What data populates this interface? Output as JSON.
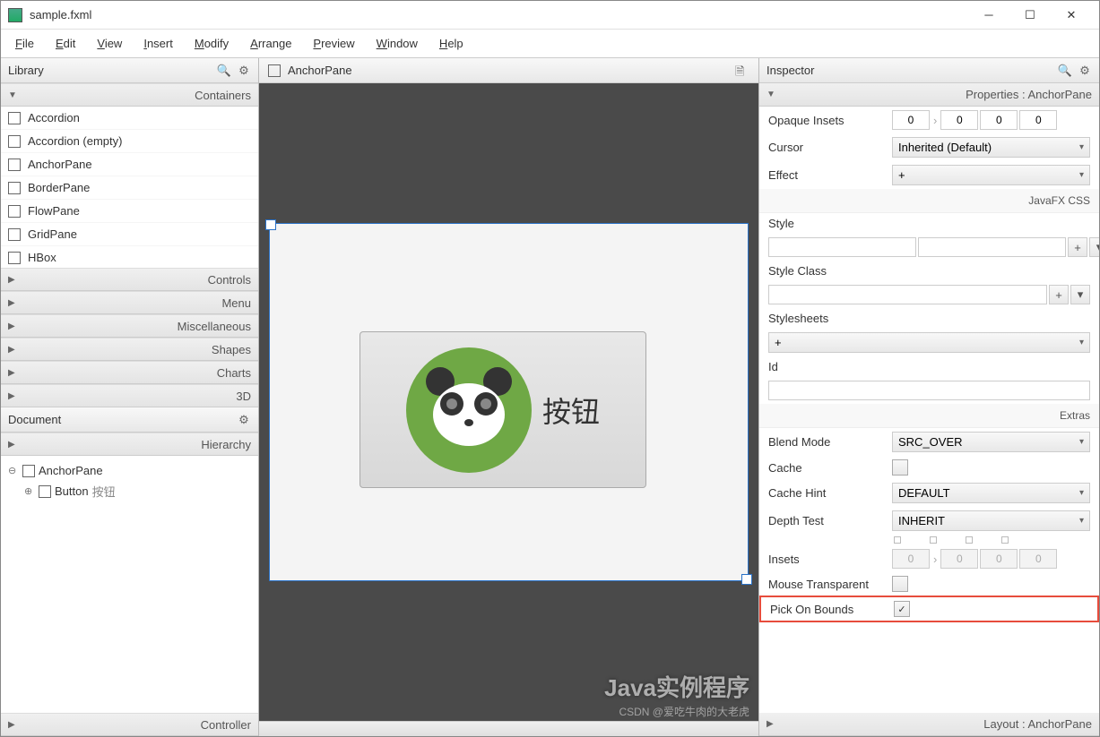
{
  "window": {
    "title": "sample.fxml"
  },
  "menu": [
    "File",
    "Edit",
    "View",
    "Insert",
    "Modify",
    "Arrange",
    "Preview",
    "Window",
    "Help"
  ],
  "library": {
    "title": "Library",
    "sections": {
      "containers": "Containers",
      "controls": "Controls",
      "menu": "Menu",
      "misc": "Miscellaneous",
      "shapes": "Shapes",
      "charts": "Charts",
      "threeD": "3D"
    },
    "containers_items": [
      "Accordion",
      "Accordion  (empty)",
      "AnchorPane",
      "BorderPane",
      "FlowPane",
      "GridPane",
      "HBox"
    ]
  },
  "document": {
    "title": "Document",
    "hierarchy": "Hierarchy",
    "controller": "Controller",
    "root": "AnchorPane",
    "child_type": "Button",
    "child_label": "按钮"
  },
  "center": {
    "root": "AnchorPane",
    "button_text": "按钮"
  },
  "inspector": {
    "title": "Inspector",
    "properties_header": "Properties : AnchorPane",
    "opaque_insets_label": "Opaque Insets",
    "opaque_insets": [
      "0",
      "0",
      "0",
      "0"
    ],
    "cursor_label": "Cursor",
    "cursor_value": "Inherited (Default)",
    "effect_label": "Effect",
    "effect_value": "+",
    "javafx_css": "JavaFX CSS",
    "style_label": "Style",
    "style_class_label": "Style Class",
    "stylesheets_label": "Stylesheets",
    "stylesheets_value": "+",
    "id_label": "Id",
    "extras": "Extras",
    "blend_mode_label": "Blend Mode",
    "blend_mode_value": "SRC_OVER",
    "cache_label": "Cache",
    "cache_hint_label": "Cache Hint",
    "cache_hint_value": "DEFAULT",
    "depth_test_label": "Depth Test",
    "depth_test_value": "INHERIT",
    "insets_label": "Insets",
    "insets": [
      "0",
      "0",
      "0",
      "0"
    ],
    "mouse_transparent_label": "Mouse Transparent",
    "pick_on_bounds_label": "Pick On Bounds",
    "layout_header": "Layout : AnchorPane"
  },
  "watermark": "Java实例程序",
  "csdn": "CSDN @爱吃牛肉的大老虎"
}
